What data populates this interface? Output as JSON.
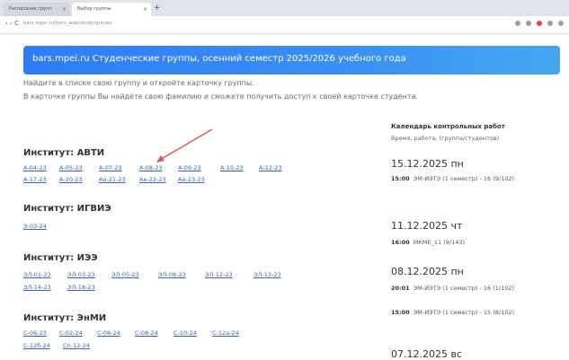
{
  "browser": {
    "tab_inactive": "Расписание групп",
    "tab_active": "Выбор группы",
    "tab_close": "×",
    "new_tab": "+",
    "nav": "‹ › C",
    "url": "bars.mpei.ru/bars_web/study/groups"
  },
  "banner": {
    "title": "bars.mpei.ru Студенческие группы, осенний семестр 2025/2026 учебного года"
  },
  "intro": {
    "line1": "Найдите в списке свою группу и откройте карточку группы.",
    "line2": "В карточке группы Вы найдёте свою фамилию и сможете получить доступ к своей карточке студента."
  },
  "institutes": [
    {
      "title": "Институт: АВТИ",
      "groups": [
        "А-04-23",
        "А-05-23",
        "А-07-23",
        "А-08-23",
        "А-09-23",
        "А-10-23",
        "А-12-23",
        "А-17-23",
        "А-20-23",
        "Ае-21-23",
        "Ае-22-23",
        "Ае-23-23"
      ]
    },
    {
      "title": "Институт: ИГВИЭ",
      "groups": [
        "Э-03-24"
      ]
    },
    {
      "title": "Институт: ИЭЭ",
      "groups": [
        "ЭЛ-01-23",
        "ЭЛ-03-23",
        "ЭЛ-05-23",
        "ЭЛ-08-23",
        "ЭЛ-12-23",
        "ЭЛ-13-23",
        "ЭЛ-14-23",
        "ЭЛ-18-23"
      ]
    },
    {
      "title": "Институт: ЭнМИ",
      "groups": [
        "С-06-23",
        "С-02-24",
        "С-06-24",
        "С-08-24",
        "С-10-24",
        "С-12а-24",
        "С-12б-24",
        "Сп-12-24"
      ]
    }
  ],
  "sidebar": {
    "title": "Календарь контрольных работ",
    "subtitle": "Время, работа, (группа/студентов)",
    "days": [
      {
        "date": "15.12.2025 пн",
        "events": [
          {
            "time": "15:00",
            "text": "ЭМ-ИЭТЭ (1 семестр) - 16 (9/102)"
          }
        ]
      },
      {
        "date": "11.12.2025 чт",
        "events": [
          {
            "time": "16:00",
            "text": "МКМЕ_11 (9/143)"
          }
        ]
      },
      {
        "date": "08.12.2025 пн",
        "events": [
          {
            "time": "20:01",
            "text": "ЭМ-ИЭТЭ (1 семестр) - 16 (1/102)"
          },
          {
            "time": "15:00",
            "text": "ЭМ-ИЭТЭ (1 семестр) - 15 (8/102)"
          }
        ]
      },
      {
        "date": "07.12.2025 вс",
        "events": []
      }
    ]
  },
  "colors": {
    "accent": "#2e7cf6",
    "link": "#3a66b5",
    "arrow": "#e05555"
  }
}
